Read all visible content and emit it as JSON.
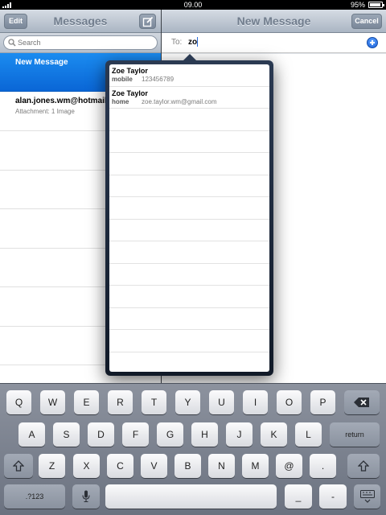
{
  "status_bar": {
    "time": "09.00",
    "battery": "95%"
  },
  "master": {
    "title": "Messages",
    "edit_label": "Edit",
    "compose_icon": "compose-icon",
    "search_placeholder": "Search",
    "threads": [
      {
        "title": "New Message",
        "subtitle": "",
        "selected": true
      },
      {
        "title": "alan.jones.wm@hotmail.com",
        "subtitle": "Attachment: 1 Image",
        "selected": false
      }
    ]
  },
  "detail": {
    "title": "New Message",
    "cancel_label": "Cancel",
    "to_label": "To:",
    "to_value": "zo",
    "add_icon": "add-contact-icon"
  },
  "suggestions": [
    {
      "name": "Zoe Taylor",
      "type": "mobile",
      "value": "123456789"
    },
    {
      "name": "Zoe Taylor",
      "type": "home",
      "value": "zoe.taylor.wm@gmail.com"
    }
  ],
  "keyboard": {
    "row1": [
      "Q",
      "W",
      "E",
      "R",
      "T",
      "Y",
      "U",
      "I",
      "O",
      "P"
    ],
    "row2": [
      "A",
      "S",
      "D",
      "F",
      "G",
      "H",
      "J",
      "K",
      "L"
    ],
    "row3": [
      "Z",
      "X",
      "C",
      "V",
      "B",
      "N",
      "M",
      "@",
      "."
    ],
    "return_label": "return",
    "numbers_label": ".?123",
    "underscore_label": "_",
    "dash_label": "-",
    "icons": [
      "backspace-icon",
      "shift-icon",
      "microphone-icon",
      "hide-keyboard-icon"
    ]
  },
  "colors": {
    "selection_blue": "#0a66d6",
    "bar_gray": "#aab5c3",
    "keyboard_bg": "#6b7280"
  }
}
